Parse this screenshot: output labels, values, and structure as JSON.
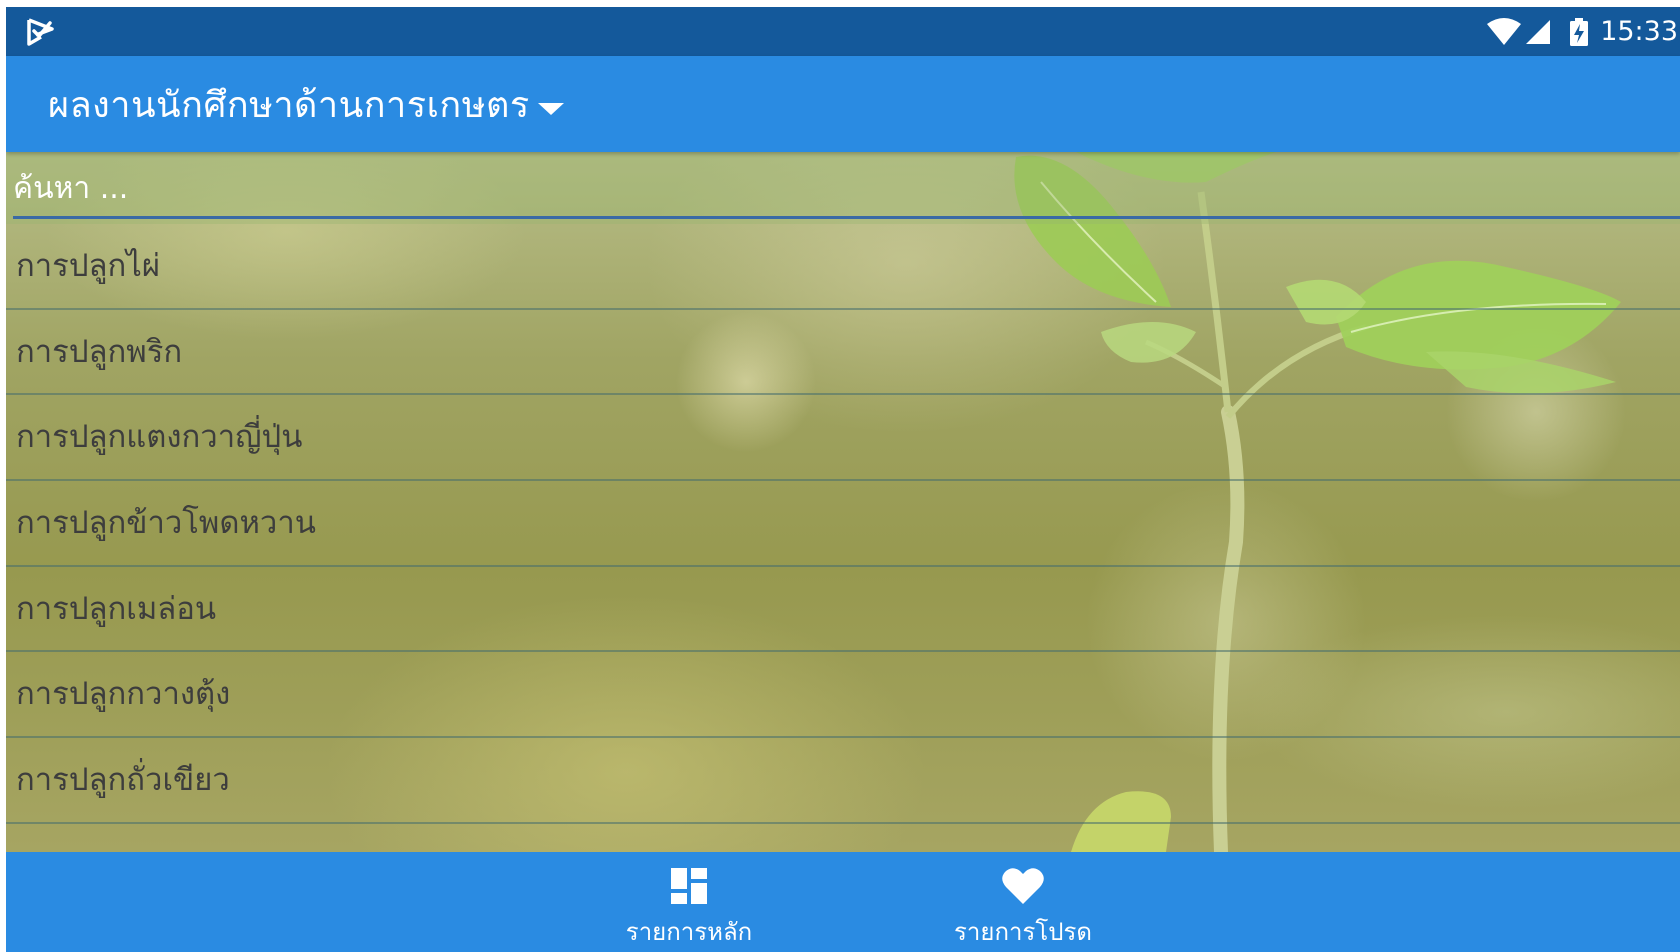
{
  "status_bar": {
    "time": "15:33",
    "icons": [
      "app-logo-icon",
      "wifi-icon",
      "signal-icon",
      "battery-charging-icon"
    ]
  },
  "app_bar": {
    "title": "ผลงานนักศึกษาด้านการเกษตร",
    "dropdown_icon": "caret-down-icon"
  },
  "search": {
    "placeholder": "ค้นหา ..."
  },
  "list": {
    "items": [
      "การปลูกไผ่",
      "การปลูกพริก",
      "การปลูกแตงกวาญี่ปุ่น",
      "การปลูกข้าวโพดหวาน",
      "การปลูกเมล่อน",
      "การปลูกกวางตุ้ง",
      "การปลูกถั่วเขียว"
    ]
  },
  "bottom_nav": {
    "main_label": "รายการหลัก",
    "main_icon": "dashboard-icon",
    "favorites_label": "รายการโปรด",
    "favorites_icon": "heart-icon"
  },
  "colors": {
    "status_bar": "#14599b",
    "app_bar": "#2a8be2",
    "bottom_nav": "#2a8be2",
    "list_text": "#3d3d3d",
    "divider": "#466e6e"
  }
}
